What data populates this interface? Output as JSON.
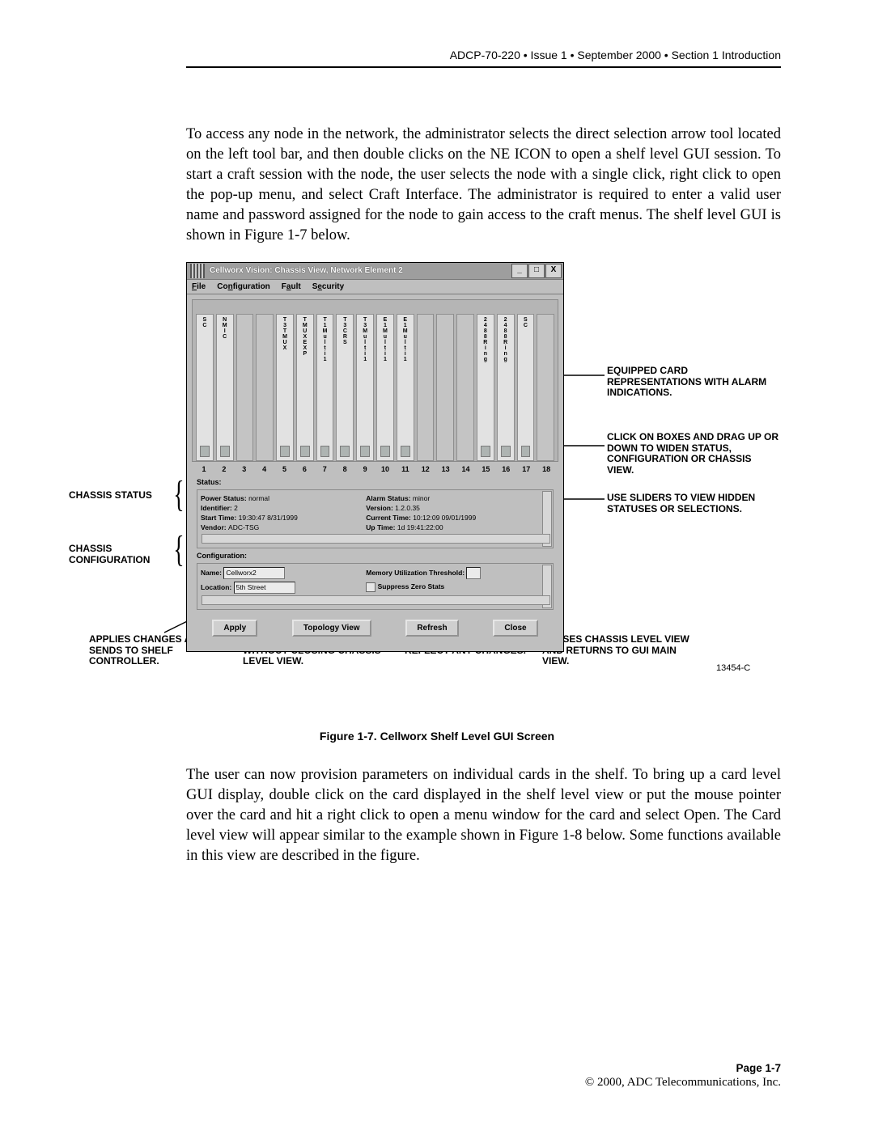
{
  "header": "ADCP-70-220 • Issue 1 • September 2000 • Section 1 Introduction",
  "para1": "To access any node in the network, the administrator selects the direct selection arrow tool located on the left tool bar, and then double clicks on the NE ICON to open a shelf level GUI session. To start a craft session with the node, the user selects the node with a single click, right click to open the pop-up menu, and select Craft Interface. The administrator is required to enter a valid user name and password assigned for the node to gain access to the craft menus. The shelf level GUI is shown in Figure 1-7 below.",
  "para2": "The user can now provision parameters on individual cards in the shelf. To bring up a card level GUI display, double click on the card displayed in the shelf level view or put the mouse pointer over the card and hit a right click to open a menu window for the card and select Open. The Card level view will appear similar to the example shown in Figure 1-8 below. Some functions available in this view are described in the figure.",
  "caption": "Figure 1-7. Cellworx Shelf Level GUI Screen",
  "figid": "13454-C",
  "footer": {
    "page": "Page 1-7",
    "copyright": "© 2000, ADC Telecommunications, Inc."
  },
  "gui": {
    "title": "Cellworx Vision:   Chassis View,    Network Element 2",
    "winbtns": {
      "min": "_",
      "max": "□",
      "close": "X"
    },
    "menu": {
      "file": "File",
      "config": "Configuration",
      "fault": "Fault",
      "security": "Security"
    },
    "slot_labels": [
      "S\nC",
      "N\nM\nI\nC",
      "",
      "",
      "T\n3\nT\nM\nU\nX",
      "T\nM\nU\nX\nE\nX\nP",
      "T\n1\nM\nu\nl\nt\ni\n1",
      "T\n3\nC\nR\nS",
      "T\n3\nM\nu\nl\nt\ni\n1",
      "E\n1\nM\nu\nl\nt\ni\n1",
      "E\n1\nM\nu\nl\nt\ni\n1",
      "",
      "",
      "",
      "2\n4\n8\n8\nR\ni\nn\ng",
      "2\n4\n8\n8\nR\ni\nn\ng",
      "S\nC",
      ""
    ],
    "slot_nums": [
      "1",
      "2",
      "3",
      "4",
      "5",
      "6",
      "7",
      "8",
      "9",
      "10",
      "11",
      "12",
      "13",
      "14",
      "15",
      "16",
      "17",
      "18"
    ],
    "status": {
      "heading": "Status:",
      "power": {
        "k": "Power Status:",
        "v": "normal"
      },
      "ident": {
        "k": "Identifier:",
        "v": "2"
      },
      "start": {
        "k": "Start Time:",
        "v": "19:30:47 8/31/1999"
      },
      "vendor": {
        "k": "Vendor:",
        "v": "ADC-TSG"
      },
      "alarm": {
        "k": "Alarm Status:",
        "v": "minor"
      },
      "version": {
        "k": "Version:",
        "v": "1.2.0.35"
      },
      "curtime": {
        "k": "Current Time:",
        "v": "10:12:09 09/01/1999"
      },
      "uptime": {
        "k": "Up Time:",
        "v": "1d 19:41:22:00"
      }
    },
    "config": {
      "heading": "Configuration:",
      "name": {
        "k": "Name:",
        "v": "Cellworx2"
      },
      "loc": {
        "k": "Location:",
        "v": "5th Street"
      },
      "mem": "Memory Utilization Threshold:",
      "supp": "Suppress Zero Stats"
    },
    "btns": {
      "apply": "Apply",
      "topo": "Topology View",
      "refresh": "Refresh",
      "close": "Close"
    }
  },
  "ann": {
    "chassis_status": "CHASSIS STATUS",
    "chassis_config": "CHASSIS\nCONFIGURATION",
    "equipped": "EQUIPPED CARD REPRESENTATIONS WITH ALARM INDICATIONS.",
    "drag": "CLICK ON BOXES AND DRAG UP OR DOWN TO WIDEN STATUS, CONFIGURATION OR CHASSIS VIEW.",
    "sliders": "USE SLIDERS TO VIEW HIDDEN STATUSES OR SELECTIONS.",
    "apply": "APPLIES CHANGES AND SENDS TO SHELF CONTROLLER.",
    "topo": "RETURNS TO GUI MAIN VIEW WITHOUT CLOSING CHASSIS LEVEL VIEW.",
    "refresh": "REPAINTS WINDOW TO REFLECT ANY CHANGES.",
    "close": "CLOSES CHASSIS LEVEL VIEW AND RETURNS TO GUI MAIN VIEW."
  }
}
